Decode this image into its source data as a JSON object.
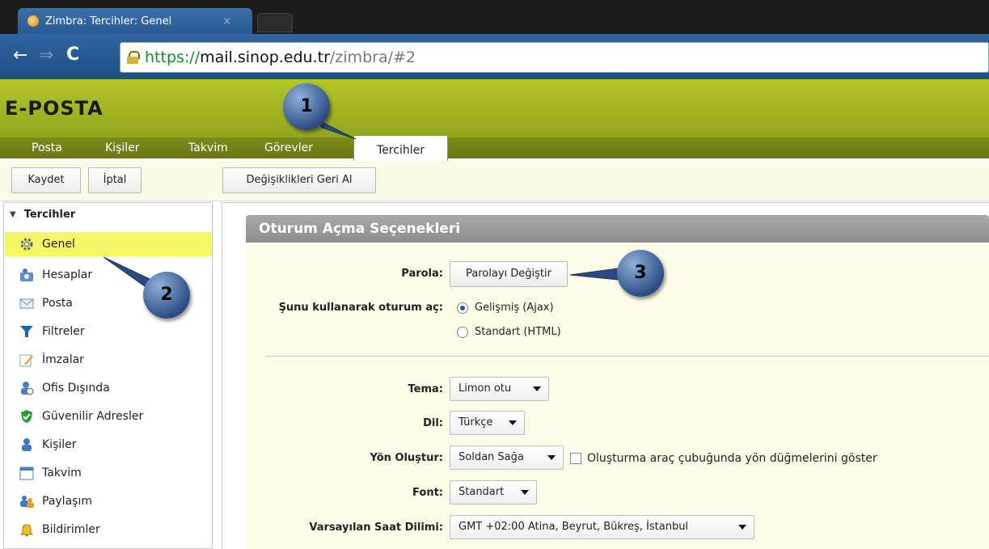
{
  "browser": {
    "tab_title": "Zimbra: Tercihler: Genel",
    "tab_close": "×",
    "url": {
      "scheme": "https://",
      "host": "mail.sinop.edu.tr",
      "path": "/zimbra/#2"
    }
  },
  "app": {
    "logo": "E-POSTA",
    "tabs": [
      "Posta",
      "Kişiler",
      "Takvim",
      "Görevler",
      "Tercihler"
    ],
    "active_tab": "Tercihler"
  },
  "toolbar": {
    "save_label": "Kaydet",
    "cancel_label": "İptal",
    "revert_label": "Değişiklikleri Geri Al"
  },
  "sidebar": {
    "header": "Tercihler",
    "items": [
      {
        "label": "Genel",
        "icon": "gear-icon",
        "selected": true
      },
      {
        "label": "Hesaplar",
        "icon": "accounts-icon"
      },
      {
        "label": "Posta",
        "icon": "mail-icon"
      },
      {
        "label": "Filtreler",
        "icon": "filter-icon"
      },
      {
        "label": "İmzalar",
        "icon": "signature-icon"
      },
      {
        "label": "Ofis Dışında",
        "icon": "out-of-office-icon"
      },
      {
        "label": "Güvenilir Adresler",
        "icon": "shield-icon"
      },
      {
        "label": "Kişiler",
        "icon": "contacts-icon"
      },
      {
        "label": "Takvim",
        "icon": "calendar-icon"
      },
      {
        "label": "Paylaşım",
        "icon": "sharing-icon"
      },
      {
        "label": "Bildirimler",
        "icon": "bell-icon"
      }
    ]
  },
  "panel": {
    "title": "Oturum Açma Seçenekleri",
    "password_label": "Parola:",
    "password_button": "Parolayı Değiştir",
    "login_label": "Şunu kullanarak oturum aç:",
    "login_options": [
      "Gelişmiş (Ajax)",
      "Standart (HTML)"
    ],
    "login_selected": "Gelişmiş (Ajax)",
    "theme_label": "Tema:",
    "theme_value": "Limon otu",
    "language_label": "Dil:",
    "language_value": "Türkçe",
    "direction_label": "Yön Oluştur:",
    "direction_value": "Soldan Sağa",
    "direction_checkbox": "Oluşturma araç çubuğunda yön düğmelerini göster",
    "font_label": "Font:",
    "font_value": "Standart",
    "timezone_label": "Varsayılan Saat Dilimi:",
    "timezone_value": "GMT +02:00 Atina, Beyrut, Bükreş, İstanbul"
  },
  "callouts": [
    "1",
    "2",
    "3"
  ]
}
